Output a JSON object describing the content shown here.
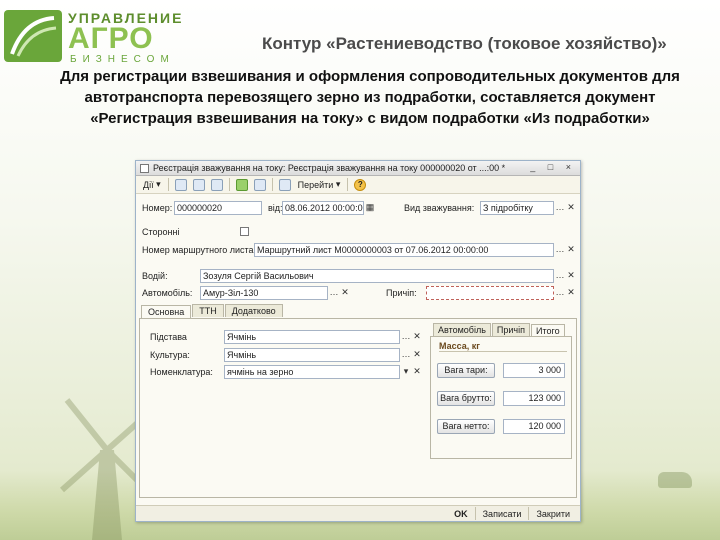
{
  "logo": {
    "top": "УПРАВЛЕНИЕ",
    "mid": "АГРО",
    "bottom": "БИЗНЕСОМ"
  },
  "slide": {
    "title": "Контур «Растениеводство (токовое хозяйство)»",
    "headline": "Для регистрации взвешивания и оформления сопроводительных документов для автотранспорта перевозящего зерно из подработки, составляется документ «Регистрация взвешивания на току» с видом подработки «Из подработки»"
  },
  "window": {
    "title": "Реєстрація зважування на току: Реєстрація зважування на току 000000020 от ...:00 *",
    "controls": "_ □ ×"
  },
  "toolbar": {
    "actions": "Дії",
    "goto": "Перейти",
    "help": "?"
  },
  "form": {
    "number_label": "Номер:",
    "number": "000000020",
    "date_label": "від:",
    "date": "08.06.2012 00:00:00",
    "kind_label": "Вид зважування:",
    "kind": "З підробітку",
    "third_party_label": "Сторонні",
    "route_label": "Номер маршрутного листа:",
    "route": "Маршрутний лист М0000000003 от 07.06.2012 00:00:00",
    "driver_label": "Водій:",
    "driver": "Зозуля Сергій Васильович",
    "car_label": "Автомобіль:",
    "car": "Амур-Зіл-130",
    "trailer_label": "Причіп:",
    "trailer": ""
  },
  "tabs": [
    "Основна",
    "ТТН",
    "Додатково"
  ],
  "main": {
    "basis_label": "Підстава",
    "basis": "Ячмінь",
    "culture_label": "Культура:",
    "culture": "Ячмінь",
    "nomen_label": "Номенклатура:",
    "nomen": "ячмінь на зерно"
  },
  "subtabs": [
    "Автомобіль",
    "Причіп",
    "Итого"
  ],
  "mass": {
    "title": "Масса, кг",
    "tare_label": "Вага тари:",
    "tare": "3 000",
    "gross_label": "Вага брутто:",
    "gross": "123 000",
    "net_label": "Вага нетто:",
    "net": "120 000"
  },
  "status": {
    "ok": "OK",
    "save": "Записати",
    "close": "Закрити"
  }
}
